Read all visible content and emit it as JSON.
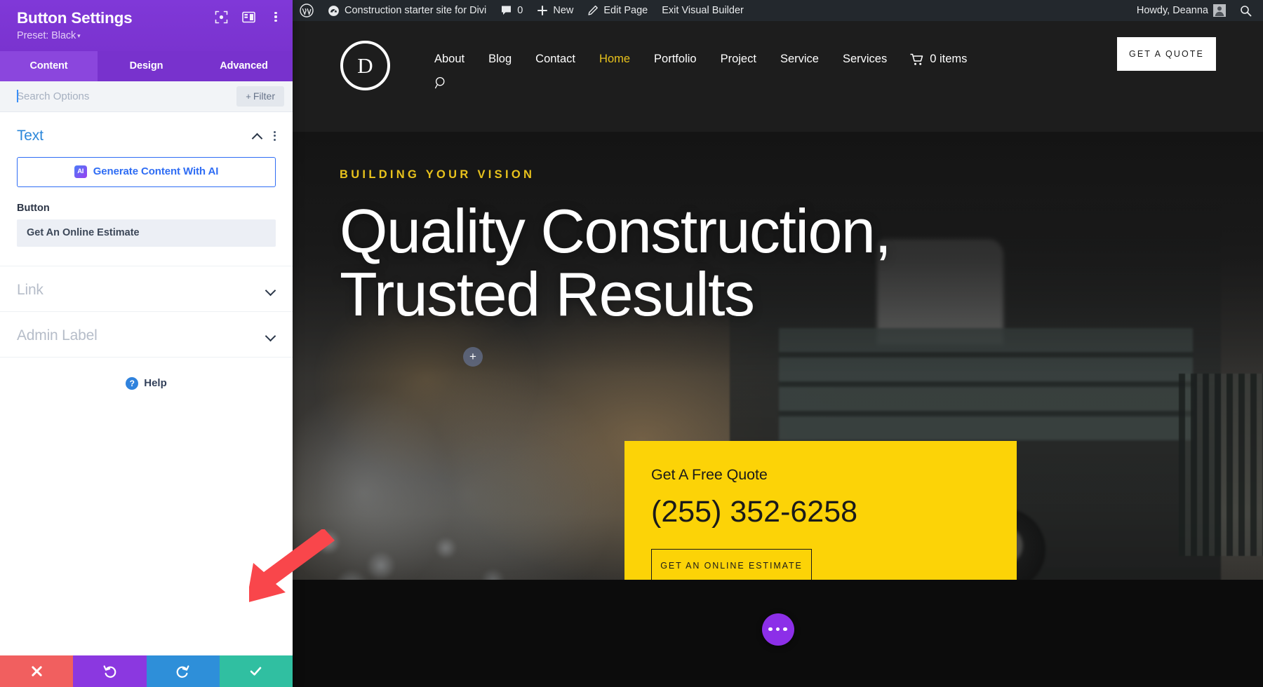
{
  "settings_panel": {
    "title": "Button Settings",
    "preset_label": "Preset: Black",
    "preset_caret": "▾",
    "icons": [
      {
        "name": "focus-target-icon"
      },
      {
        "name": "layout-panel-icon"
      },
      {
        "name": "kebab-menu-icon"
      }
    ],
    "tabs": [
      {
        "label": "Content",
        "active": true
      },
      {
        "label": "Design",
        "active": false
      },
      {
        "label": "Advanced",
        "active": false
      }
    ],
    "search": {
      "value": "",
      "placeholder": "Search Options"
    },
    "filter_button": {
      "plus": "+",
      "label": "Filter"
    },
    "sections": [
      {
        "title": "Text",
        "expanded": true,
        "ai_button": {
          "badge": "AI",
          "label": "Generate Content With AI"
        },
        "field_label": "Button",
        "field_value": "Get An Online Estimate"
      },
      {
        "title": "Link",
        "expanded": false
      },
      {
        "title": "Admin Label",
        "expanded": false
      }
    ],
    "help": {
      "glyph": "?",
      "label": "Help"
    },
    "footer_buttons": [
      {
        "name": "cancel-button",
        "icon": "close-icon",
        "color": "#f15f5f"
      },
      {
        "name": "undo-button",
        "icon": "undo-icon",
        "color": "#8b38e0"
      },
      {
        "name": "redo-button",
        "icon": "redo-icon",
        "color": "#2e8fd9"
      },
      {
        "name": "save-button",
        "icon": "check-icon",
        "color": "#30bfa1"
      }
    ]
  },
  "admin_bar": {
    "site_name": "Construction starter site for Divi",
    "comments_count": "0",
    "new_label": "New",
    "edit_page_label": "Edit Page",
    "exit_builder_label": "Exit Visual Builder",
    "howdy": "Howdy, Deanna"
  },
  "site": {
    "logo_letter": "D",
    "nav": [
      {
        "label": "About",
        "current": false
      },
      {
        "label": "Blog",
        "current": false
      },
      {
        "label": "Contact",
        "current": false
      },
      {
        "label": "Home",
        "current": true
      },
      {
        "label": "Portfolio",
        "current": false
      },
      {
        "label": "Project",
        "current": false
      },
      {
        "label": "Service",
        "current": false
      },
      {
        "label": "Services",
        "current": false
      }
    ],
    "cart_label": "0 items",
    "header_cta": "GET A QUOTE",
    "hero": {
      "eyebrow": "BUILDING YOUR VISION",
      "title": "Quality Construction, Trusted Results"
    },
    "quote_card": {
      "title": "Get A Free Quote",
      "phone": "(255) 352-6258",
      "button": "GET AN ONLINE ESTIMATE"
    }
  },
  "colors": {
    "panel_purple": "#7e3bd0",
    "tab_active": "#8b46dd",
    "accent_yellow": "#fcd307",
    "nav_current": "#e8c21c",
    "link_blue": "#2b87da",
    "ai_blue": "#2f6df4",
    "arrow_red": "#f9464b",
    "fab_purple": "#8c2fe8"
  }
}
